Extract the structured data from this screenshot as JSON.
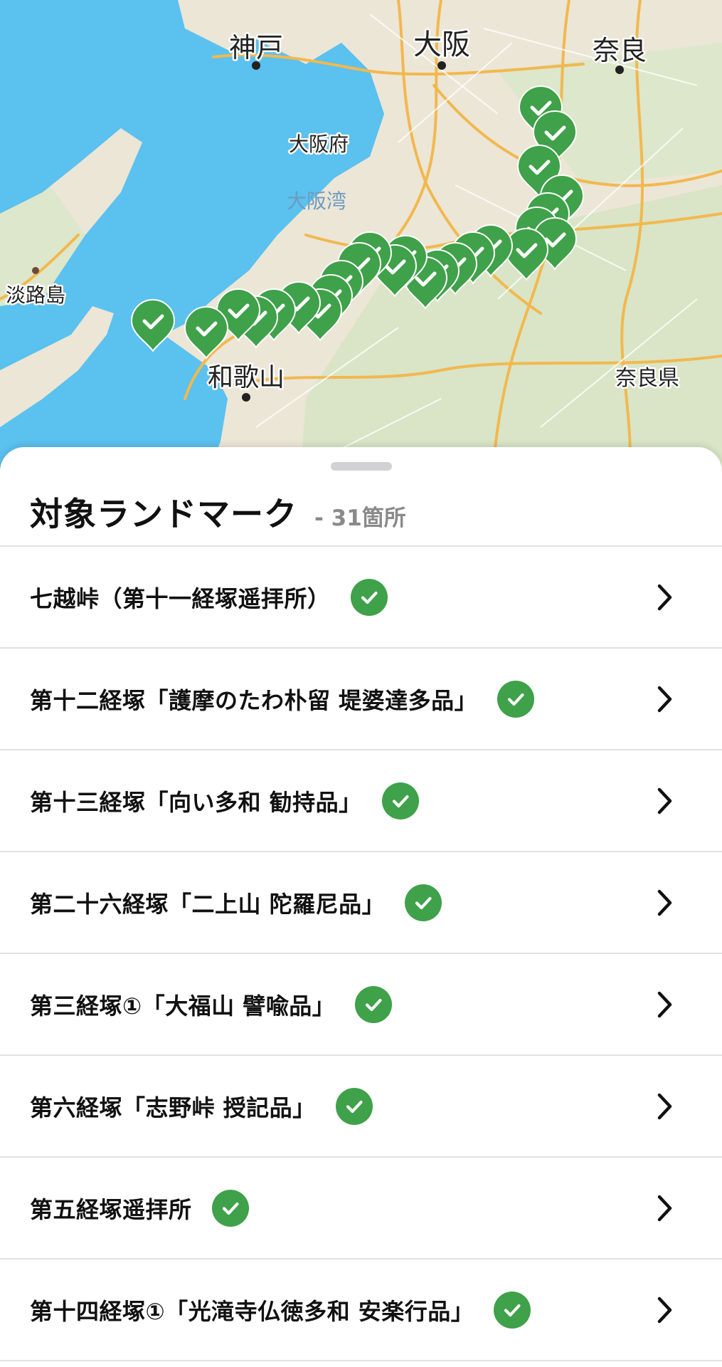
{
  "map": {
    "labels": {
      "kobe": "神戸",
      "osaka": "大阪",
      "nara": "奈良",
      "osaka_pref": "大阪府",
      "osaka_bay": "大阪湾",
      "awaji": "淡路島",
      "wakayama": "和歌山",
      "nara_pref": "奈良県"
    },
    "colors": {
      "water": "#5bc1ee",
      "land": "#ece6d7",
      "green_land": "#d6e4c3",
      "road": "#f2b84f",
      "pin": "#3fa149"
    },
    "pin_icon": "checkmark-icon"
  },
  "sheet": {
    "title": "対象ランドマーク",
    "count": "- 31箇所"
  },
  "landmarks": [
    {
      "label": "七越峠（第十一経塚遥拝所）"
    },
    {
      "label": "第十二経塚「護摩のたわ朴留 堤婆達多品」"
    },
    {
      "label": "第十三経塚「向い多和 勧持品」"
    },
    {
      "label": "第二十六経塚「二上山 陀羅尼品」"
    },
    {
      "label": "第三経塚①「大福山 譬喩品」"
    },
    {
      "label": "第六経塚「志野峠 授記品」"
    },
    {
      "label": "第五経塚遥拝所"
    },
    {
      "label": "第十四経塚①「光滝寺仏徳多和 安楽行品」"
    }
  ],
  "icons": {
    "status": "check-circle-icon",
    "row_action": "chevron-right-icon"
  }
}
